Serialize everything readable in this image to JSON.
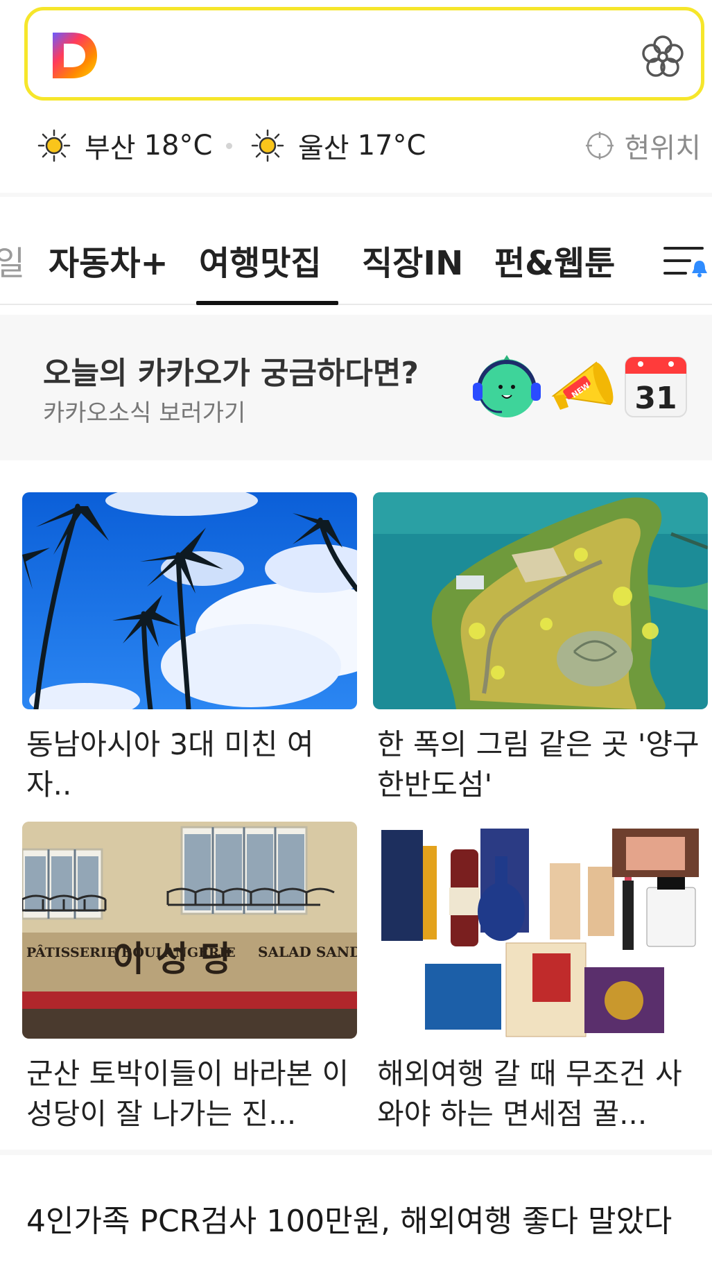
{
  "search": {
    "logo": "daum-logo",
    "right_icon": "flower-icon",
    "accent_color": "#f6e62b"
  },
  "weather": {
    "items": [
      {
        "city": "부산",
        "temp": "18°C",
        "icon": "sun-icon"
      },
      {
        "city": "울산",
        "temp": "17°C",
        "icon": "sun-icon"
      }
    ],
    "location_label": "현위치"
  },
  "tabs": {
    "items": [
      {
        "label": "일",
        "partial": true
      },
      {
        "label": "자동차+"
      },
      {
        "label": "여행맛집",
        "active": true
      },
      {
        "label": "직장IN"
      },
      {
        "label": "펀&웹툰"
      }
    ],
    "menu_icon": "menu-with-notification-icon"
  },
  "banner": {
    "title": "오늘의 카카오가 궁금하다면?",
    "subtitle": "카카오소식 보러가기",
    "calendar_day": "31",
    "megaphone_text": "NEW"
  },
  "articles": [
    {
      "title": "동남아시아 3대 미친 여자..",
      "image": "palm-trees-sky"
    },
    {
      "title": "한 폭의 그림 같은 곳 '양구 한반도섬'",
      "image": "island-aerial"
    },
    {
      "title": "군산 토박이들이 바라본 이성당이 잘 나가는 진...",
      "image": "bakery-storefront",
      "sign": {
        "left": "PÂTISSERIE BOULANGERIE",
        "center": "이 성 당",
        "right": "SALAD SANDWICH"
      }
    },
    {
      "title": "해외여행 갈 때 무조건 사와야 하는 면세점 꿀...",
      "image": "duty-free-products"
    }
  ],
  "headline": "4인가족 PCR검사 100만원, 해외여행 좋다 말았다"
}
